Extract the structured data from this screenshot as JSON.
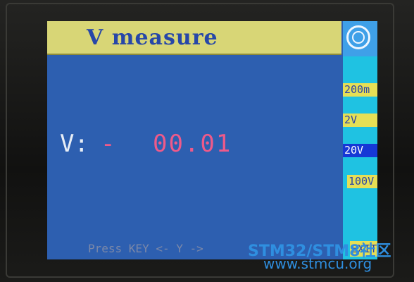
{
  "title": "V measure",
  "menu_icon": "target-ring-icon",
  "ranges": [
    "200m",
    "2V",
    "20V",
    "100V"
  ],
  "active_range": "20V",
  "exit_label": "EXIT",
  "reading": {
    "label": "V:",
    "sign": "-",
    "value": "00.01"
  },
  "hint": "Press KEY  <- Y ->",
  "watermark": {
    "brand": "STM32/STM8社区",
    "url": "www.stmcu.org"
  },
  "colors": {
    "screen_bg": "#2d5fb0",
    "title_bar": "#d8d676",
    "side_panel": "#1fc2e2",
    "range_button": "#e6df55",
    "range_active": "#1638d6",
    "reading_value": "#ee5a8a"
  }
}
